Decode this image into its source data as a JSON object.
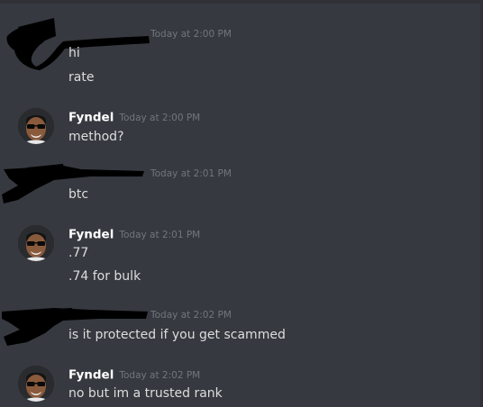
{
  "messages": [
    {
      "author": "",
      "redacted": true,
      "timestamp": "Today at 2:00 PM",
      "lines": [
        "hi",
        "rate"
      ]
    },
    {
      "author": "Fyndel",
      "redacted": false,
      "timestamp": "Today at 2:00 PM",
      "lines": [
        "method?"
      ]
    },
    {
      "author": "",
      "redacted": true,
      "timestamp": "Today at 2:01 PM",
      "lines": [
        "btc"
      ]
    },
    {
      "author": "Fyndel",
      "redacted": false,
      "timestamp": "Today at 2:01 PM",
      "lines": [
        ".77",
        ".74 for bulk"
      ]
    },
    {
      "author": "",
      "redacted": true,
      "timestamp": "Today at 2:02 PM",
      "lines": [
        "is it protected if you get scammed"
      ]
    },
    {
      "author": "Fyndel",
      "redacted": false,
      "timestamp": "Today at 2:02 PM",
      "lines": [
        "no but im a trusted rank"
      ]
    }
  ],
  "colors": {
    "background": "#36393f",
    "message_text": "#dcddde",
    "username": "#ffffff",
    "timestamp": "#72767d",
    "redaction": "#000000"
  },
  "icons": {
    "avatar": "user-avatar-sunglasses",
    "redaction": "black-scribble-redaction"
  }
}
